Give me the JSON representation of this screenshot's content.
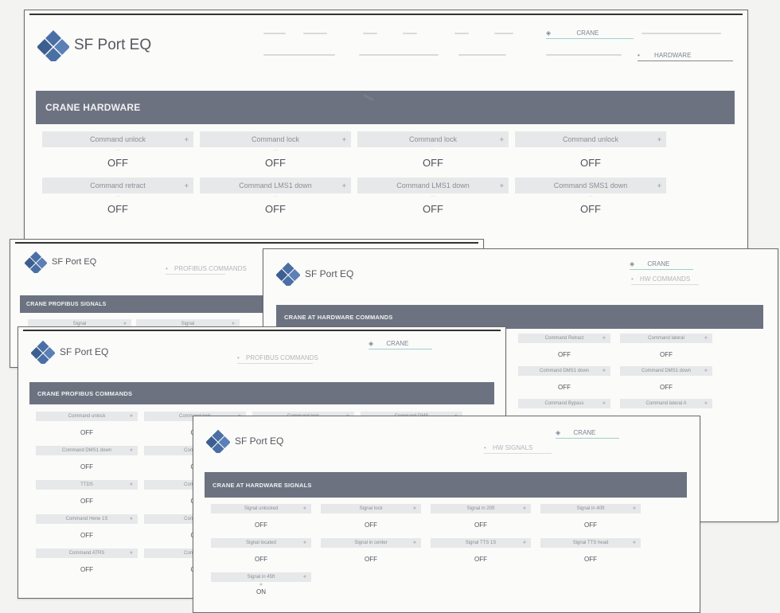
{
  "brand": {
    "name": "SF Port EQ",
    "color": "#4a6fa5"
  },
  "nav": {
    "crane_label": "CRANE",
    "hardware_label": "HARDWARE",
    "short_crane": "CRANE",
    "ppl_commands": "PROFIBUS COMMANDS",
    "hw_commands": "HW COMMANDS",
    "hw_signals": "HW SIGNALS",
    "bullet": "•"
  },
  "windows": {
    "hardware": {
      "title": "CRANE HARDWARE",
      "cells": [
        {
          "label": "Command unlock",
          "value": "OFF"
        },
        {
          "label": "Command lock",
          "value": "OFF"
        },
        {
          "label": "Command lock",
          "value": "OFF"
        },
        {
          "label": "Command unlock",
          "value": "OFF"
        },
        {
          "label": "Command retract",
          "value": "OFF"
        },
        {
          "label": "Command LMS1 down",
          "value": "OFF"
        },
        {
          "label": "Command LMS1 down",
          "value": "OFF"
        },
        {
          "label": "Command SMS1 down",
          "value": "OFF"
        }
      ]
    },
    "profibus_signals": {
      "title": "CRANE PROFIBUS SIGNALS",
      "cells": [
        {
          "label": "Signal"
        },
        {
          "label": "Signal"
        }
      ]
    },
    "hw_commands": {
      "title": "CRANE AT HARDWARE COMMANDS",
      "cells": [
        {
          "label": "Command Retract",
          "value": "OFF"
        },
        {
          "label": "Command lateral",
          "value": "OFF"
        },
        {
          "label": "Command DMS1 down",
          "value": "OFF"
        },
        {
          "label": "Command DMS1 down",
          "value": "OFF"
        },
        {
          "label": "Command Bypass",
          "value": ""
        },
        {
          "label": "Command lateral A",
          "value": ""
        }
      ]
    },
    "profibus_commands": {
      "title": "CRANE PROFIBUS COMMANDS",
      "rows": [
        [
          {
            "label": "Command unlock",
            "value": "OFF"
          },
          {
            "label": "Command lock",
            "value": "OF"
          },
          {
            "label": "Command lock",
            "value": ""
          },
          {
            "label": "Command DMS",
            "value": ""
          }
        ],
        [
          {
            "label": "Command DMS1 down",
            "value": "OFF"
          },
          {
            "label": "Command",
            "value": "OF"
          }
        ],
        [
          {
            "label": "TTDS",
            "value": "OFF"
          },
          {
            "label": "Command",
            "value": "OF"
          }
        ],
        [
          {
            "label": "Command Hene 1S",
            "value": "OFF"
          },
          {
            "label": "Command",
            "value": "OF"
          }
        ],
        [
          {
            "label": "Command ATRS",
            "value": "OFF"
          },
          {
            "label": "Command",
            "value": "OF"
          }
        ]
      ]
    },
    "hw_signals": {
      "title": "CRANE AT HARDWARE SIGNALS",
      "cells": [
        {
          "label": "Signal unlocked",
          "value": "OFF"
        },
        {
          "label": "Signal lock",
          "value": "OFF"
        },
        {
          "label": "Signal in 20ft",
          "value": "OFF"
        },
        {
          "label": "Signal in 40ft",
          "value": "OFF"
        },
        {
          "label": "Signal located",
          "value": "OFF"
        },
        {
          "label": "Signal in center",
          "value": "OFF"
        },
        {
          "label": "Signal TTS 1S",
          "value": "OFF"
        },
        {
          "label": "Signal TTS head",
          "value": "OFF"
        },
        {
          "label": "Signal in 45ft",
          "value": "ON"
        }
      ]
    }
  }
}
